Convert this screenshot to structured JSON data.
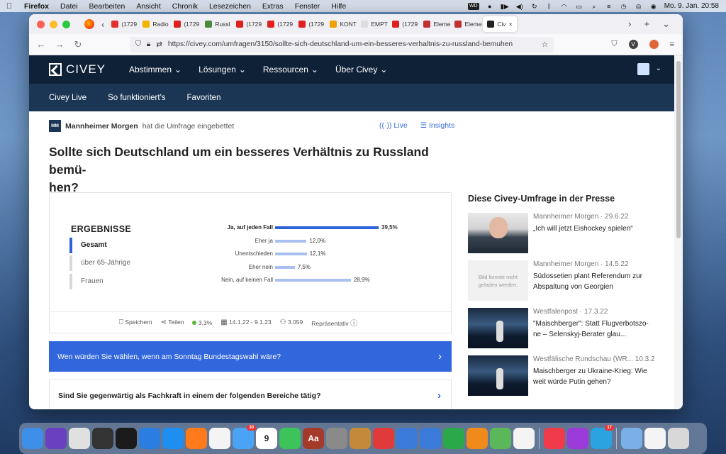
{
  "menubar": {
    "app": "Firefox",
    "items": [
      "Datei",
      "Bearbeiten",
      "Ansicht",
      "Chronik",
      "Lesezeichen",
      "Extras",
      "Fenster",
      "Hilfe"
    ],
    "wd_badge": "WD",
    "clock": "Mo. 9. Jan.  20:58"
  },
  "tabs": [
    {
      "label": "(1729",
      "color": "#e03030"
    },
    {
      "label": "Radio",
      "color": "#f0b400"
    },
    {
      "label": "(1729",
      "color": "#e02020"
    },
    {
      "label": "Russl",
      "color": "#4a8a3a"
    },
    {
      "label": "(1729",
      "color": "#e02020"
    },
    {
      "label": "(1729",
      "color": "#e02020"
    },
    {
      "label": "(1729",
      "color": "#e02020"
    },
    {
      "label": "KONTF",
      "color": "#f0a000"
    },
    {
      "label": "EMPTY",
      "color": "#dddddd"
    },
    {
      "label": "(1729",
      "color": "#e02020"
    },
    {
      "label": "Eleme",
      "color": "#c03030"
    },
    {
      "label": "Eleme",
      "color": "#c03030"
    },
    {
      "label": "Civ",
      "color": "#222222",
      "active": true
    }
  ],
  "browser": {
    "url": "https://civey.com/umfragen/3150/sollte-sich-deutschland-um-ein-besseres-verhaltnis-zu-russland-bemuhen"
  },
  "topnav": {
    "logo": "CIVEY",
    "items": [
      "Abstimmen",
      "Lösungen",
      "Ressourcen",
      "Über Civey"
    ]
  },
  "subnav": [
    "Civey Live",
    "So funktioniert's",
    "Favoriten"
  ],
  "embed": {
    "badge": "MM",
    "publisher": "Mannheimer Morgen",
    "text": "hat die Umfrage eingebettet",
    "live": "Live",
    "insights": "Insights"
  },
  "question": {
    "line1": "Sollte sich Deutschland um ein besseres Verhältnis zu Russland bemü-",
    "line2": "hen?"
  },
  "results": {
    "title": "ERGEBNISSE",
    "segments": [
      "Gesamt",
      "über 65-Jährige",
      "Frauen"
    ],
    "footer": {
      "save": "Speichern",
      "share": "Teilen",
      "error": "3,3%",
      "period": "14.1.22 - 9.1.23",
      "count": "3.059",
      "repr": "Repräsentativ"
    }
  },
  "chart_data": {
    "type": "bar",
    "orientation": "horizontal",
    "categories": [
      "Ja, auf jeden Fall",
      "Eher ja",
      "Unentschieden",
      "Eher nein",
      "Nein, auf keinen Fall"
    ],
    "values": [
      39.5,
      12.0,
      12.1,
      7.5,
      28.9
    ],
    "value_labels": [
      "39,5%",
      "12,0%",
      "12,1%",
      "7,5%",
      "28,9%"
    ],
    "unit": "%",
    "highlight_index": 0,
    "colors": {
      "highlight": "#2d62d9",
      "default": "#a9bff0"
    }
  },
  "next_questions": [
    "Wen würden Sie wählen, wenn am Sonntag Bundestagswahl wäre?",
    "Sind Sie gegenwärtig als Fachkraft in einem der folgenden Bereiche tätig?"
  ],
  "press": {
    "title": "Diese Civey-Umfrage in der Presse",
    "items": [
      {
        "source": "Mannheimer Morgen · 29.6.22",
        "title": "„Ich will jetzt Eishockey spielen“",
        "thumb": "putin"
      },
      {
        "source": "Mannheimer Morgen · 14.5.22",
        "title": "Südossetien plant Referendum zur Abspaltung von Georgien",
        "thumb": "none",
        "thumb_text": "Bild konnte nicht geladen werden."
      },
      {
        "source": "Westfalenpost · 17.3.22",
        "title": "\"Maischberger\": Statt Flugverbotszo-ne – Selenskyj-Berater glau...",
        "thumb": "studio"
      },
      {
        "source": "Westfälische Rundschau (WR... 10.3.2",
        "title": "Maischberger zu Ukraine-Krieg: Wie weit würde Putin gehen?",
        "thumb": "studio"
      }
    ]
  },
  "dock": {
    "apps": [
      {
        "name": "finder",
        "color": "#3d8fe8"
      },
      {
        "name": "siri",
        "color": "#6a3fc0"
      },
      {
        "name": "launchpad",
        "color": "#e0e0e0"
      },
      {
        "name": "mission-control",
        "color": "#333333"
      },
      {
        "name": "activity-monitor",
        "color": "#1b1b1b"
      },
      {
        "name": "app-store",
        "color": "#2a7de1"
      },
      {
        "name": "safari",
        "color": "#1f8ef1"
      },
      {
        "name": "firefox",
        "color": "#ff7a1a"
      },
      {
        "name": "chrome",
        "color": "#f4f4f4"
      },
      {
        "name": "mail",
        "color": "#4aa3f5",
        "badge": "30"
      },
      {
        "name": "calendar",
        "color": "#ffffff",
        "text": "9"
      },
      {
        "name": "facetime",
        "color": "#3cc45a"
      },
      {
        "name": "dictionary",
        "color": "#a63a2a",
        "text": "Aa"
      },
      {
        "name": "system-preferences",
        "color": "#8a8a8a"
      },
      {
        "name": "archive",
        "color": "#c48a3a"
      },
      {
        "name": "photo-booth",
        "color": "#e03a3a"
      },
      {
        "name": "preview",
        "color": "#3a7ad8"
      },
      {
        "name": "keynote",
        "color": "#3a7ad8"
      },
      {
        "name": "numbers",
        "color": "#2aa84a"
      },
      {
        "name": "pages",
        "color": "#f08a1a"
      },
      {
        "name": "maps",
        "color": "#5ab85a"
      },
      {
        "name": "photos",
        "color": "#f4f4f4"
      },
      {
        "name": "music",
        "color": "#f03a4a"
      },
      {
        "name": "podcasts",
        "color": "#9a3ad8"
      },
      {
        "name": "telegram",
        "color": "#2aa3e0",
        "badge": "17"
      },
      {
        "name": "folder",
        "color": "#7ab0e8"
      },
      {
        "name": "documents",
        "color": "#f4f4f4"
      },
      {
        "name": "trash",
        "color": "#d8d8d8"
      }
    ]
  }
}
